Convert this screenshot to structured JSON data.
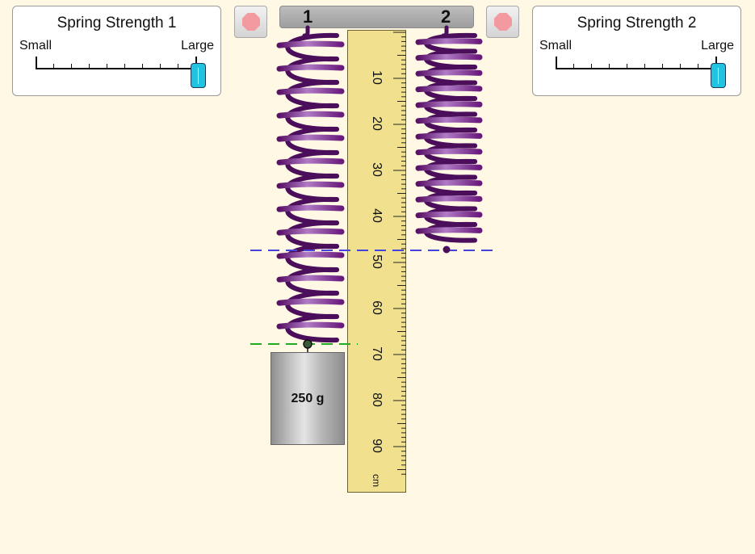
{
  "panels": [
    {
      "title": "Spring Strength 1",
      "small_label": "Small",
      "large_label": "Large",
      "level": 1.0
    },
    {
      "title": "Spring Strength 2",
      "small_label": "Small",
      "large_label": "Large",
      "level": 1.0
    }
  ],
  "springs": [
    {
      "label": "1",
      "mass_label": "250 g",
      "line_color": "#22aa22"
    },
    {
      "label": "2",
      "line_color": "#4444dd"
    }
  ],
  "ruler": {
    "labels": [
      "10",
      "20",
      "30",
      "40",
      "50",
      "60",
      "70",
      "80",
      "90"
    ],
    "unit": "cm"
  },
  "colors": {
    "background": "#fef8e4",
    "spring": "#6a1a7c",
    "slider_thumb": "#20c3e0",
    "ruler": "#f1e18e",
    "stop_icon": "#f29aa0"
  },
  "icons": [
    "stop-icon"
  ]
}
